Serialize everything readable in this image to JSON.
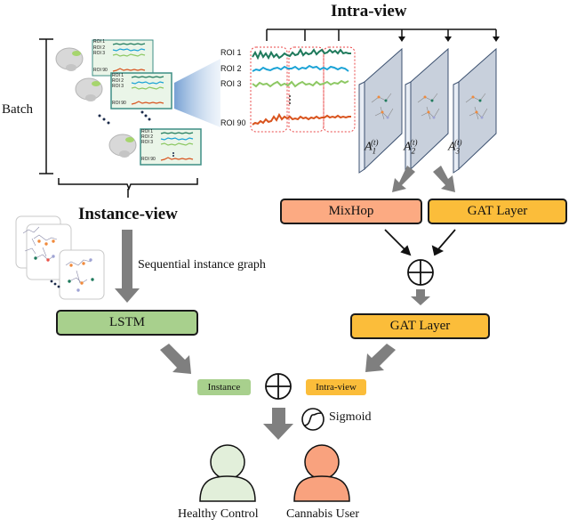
{
  "titles": {
    "intra_view": "Intra-view",
    "instance_view": "Instance-view"
  },
  "left_panel": {
    "batch_label": "Batch",
    "roi_labels": [
      "ROI 1",
      "ROI 2",
      "ROI 3",
      "ROI 90"
    ]
  },
  "intra_panel": {
    "roi_labels": [
      "ROI 1",
      "ROI 2",
      "ROI 3",
      "ROI 90"
    ],
    "adjacency_labels": [
      "A",
      "A",
      "A"
    ],
    "adjacency_subscripts": [
      "1",
      "2",
      "3"
    ],
    "adjacency_superscript": "(t)"
  },
  "boxes": {
    "mixhop": "MixHop",
    "gat_layer_1": "GAT Layer",
    "gat_layer_2": "GAT Layer",
    "lstm": "LSTM"
  },
  "labels": {
    "sequential_instance_graph": "Sequential instance graph",
    "instance_tag": "Instance",
    "intra_view_tag": "Intra-view",
    "sigmoid": "Sigmoid",
    "healthy_control": "Healthy Control",
    "cannabis_user": "Cannabis User"
  },
  "colors": {
    "mixhop": "#fcaa82",
    "gat": "#fbbd3a",
    "lstm": "#a8d08d",
    "instance_tag": "#a8d08d",
    "intra_tag": "#fbbd3a",
    "healthy_person": "#e2efda",
    "cannabis_person": "#f9a27e",
    "roi1": "#1f7a5c",
    "roi2": "#1ba3d6",
    "roi3": "#8dc863",
    "roi90": "#d9541e"
  }
}
